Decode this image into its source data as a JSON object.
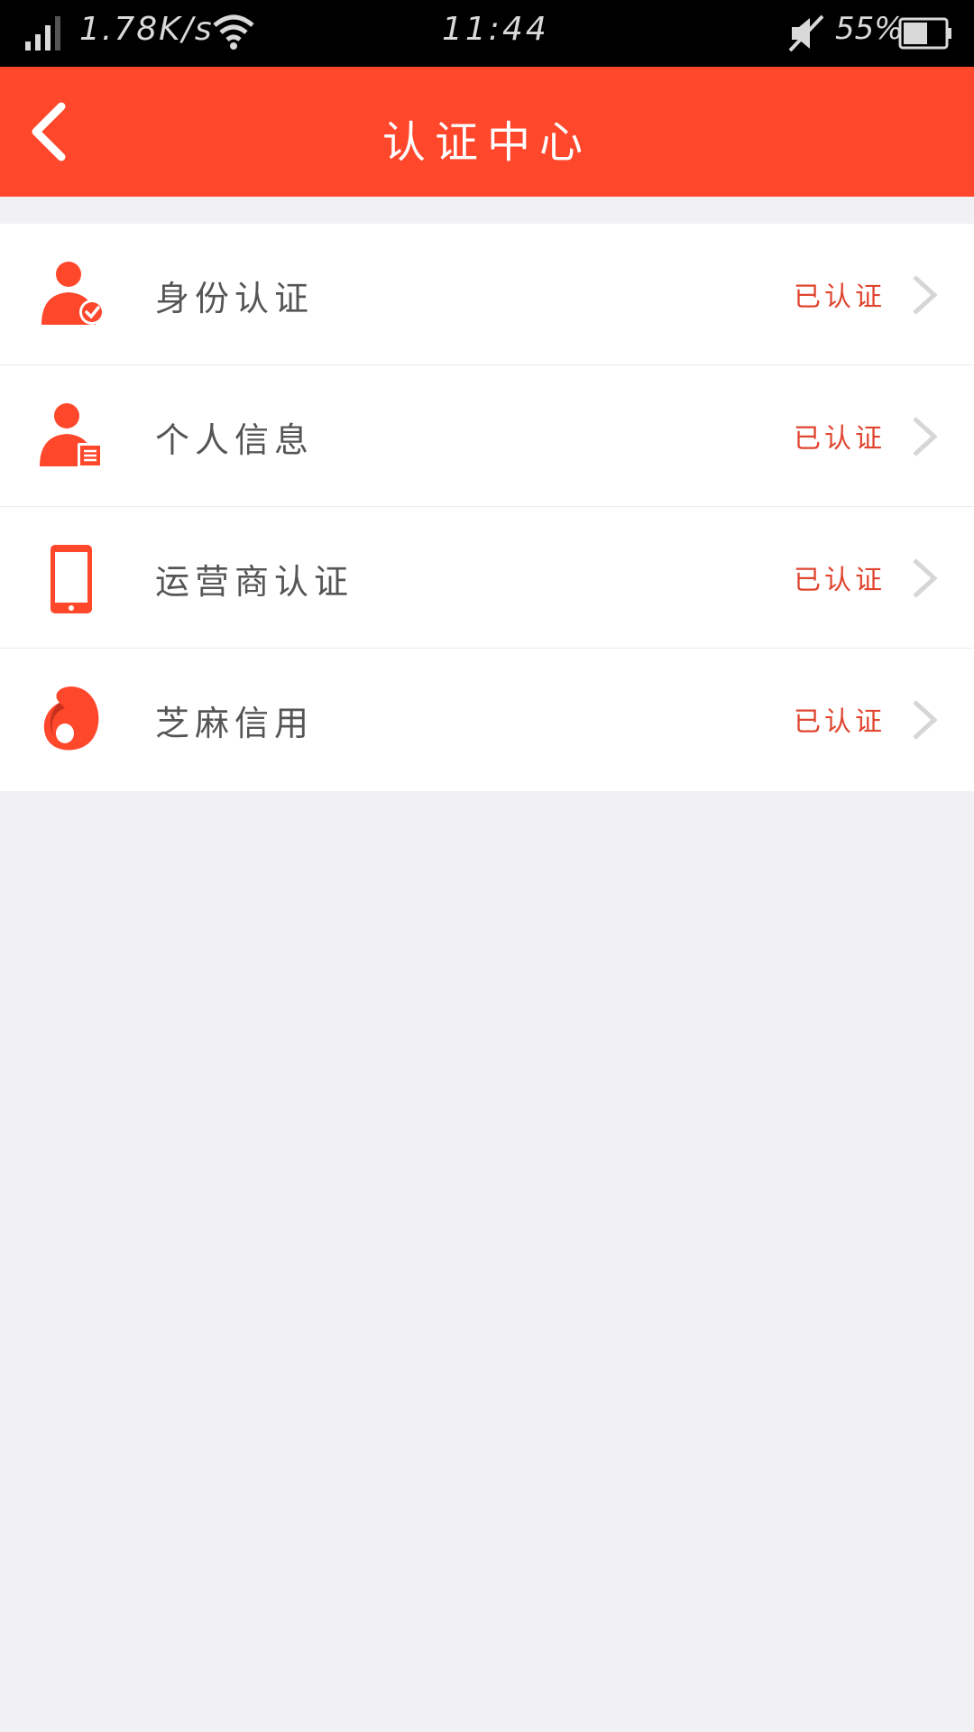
{
  "status_bar": {
    "speed": "1.78K/s",
    "time": "11:44",
    "battery": "55%"
  },
  "header": {
    "title": "认证中心",
    "back_icon": "back-arrow-icon"
  },
  "items": [
    {
      "label": "身份认证",
      "status": "已认证",
      "icon": "identity-verify-icon"
    },
    {
      "label": "个人信息",
      "status": "已认证",
      "icon": "personal-info-icon"
    },
    {
      "label": "运营商认证",
      "status": "已认证",
      "icon": "phone-icon"
    },
    {
      "label": "芝麻信用",
      "status": "已认证",
      "icon": "sesame-credit-icon"
    }
  ],
  "colors": {
    "accent": "#fe472b",
    "status_text": "#e0452f",
    "background": "#f1f1f5"
  }
}
